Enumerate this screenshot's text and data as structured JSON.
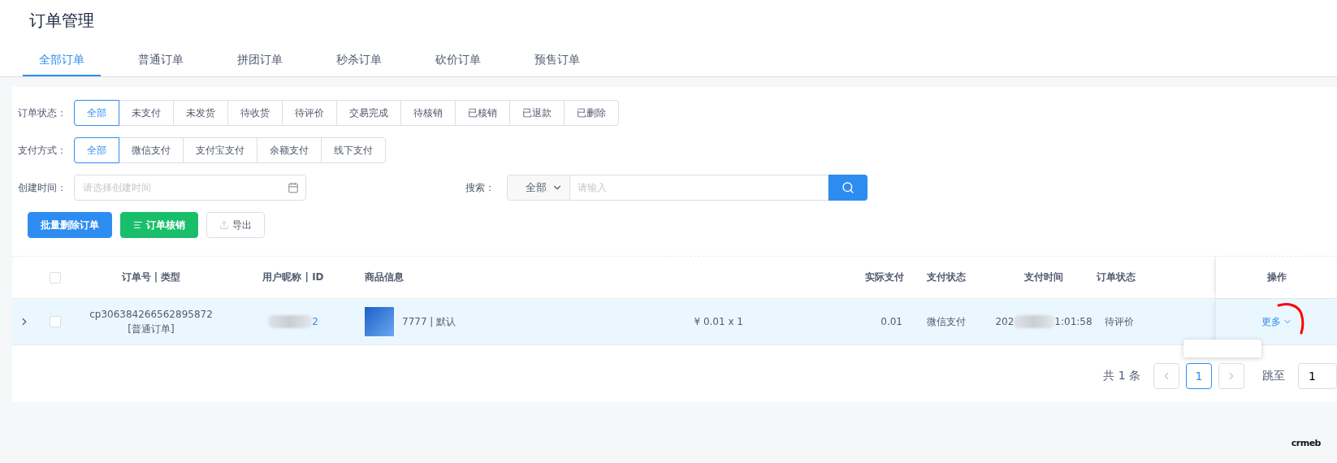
{
  "page": {
    "title": "订单管理"
  },
  "tabs": [
    {
      "label": "全部订单",
      "selected": true
    },
    {
      "label": "普通订单",
      "selected": false
    },
    {
      "label": "拼团订单",
      "selected": false
    },
    {
      "label": "秒杀订单",
      "selected": false
    },
    {
      "label": "砍价订单",
      "selected": false
    },
    {
      "label": "预售订单",
      "selected": false
    }
  ],
  "filters": {
    "order_status": {
      "label": "订单状态：",
      "options": [
        {
          "label": "全部",
          "selected": true
        },
        {
          "label": "未支付",
          "selected": false
        },
        {
          "label": "未发货",
          "selected": false
        },
        {
          "label": "待收货",
          "selected": false
        },
        {
          "label": "待评价",
          "selected": false
        },
        {
          "label": "交易完成",
          "selected": false
        },
        {
          "label": "待核销",
          "selected": false
        },
        {
          "label": "已核销",
          "selected": false
        },
        {
          "label": "已退款",
          "selected": false
        },
        {
          "label": "已删除",
          "selected": false
        }
      ]
    },
    "payment_method": {
      "label": "支付方式：",
      "options": [
        {
          "label": "全部",
          "selected": true
        },
        {
          "label": "微信支付",
          "selected": false
        },
        {
          "label": "支付宝支付",
          "selected": false
        },
        {
          "label": "余额支付",
          "selected": false
        },
        {
          "label": "线下支付",
          "selected": false
        }
      ]
    },
    "created_time": {
      "label": "创建时间：",
      "placeholder": "请选择创建时间"
    },
    "search": {
      "label": "搜索：",
      "scope": "全部",
      "placeholder": "请输入"
    }
  },
  "actions": [
    {
      "label": "批量删除订单",
      "kind": "primary"
    },
    {
      "label": "订单核销",
      "kind": "success"
    },
    {
      "label": "导出",
      "kind": "default"
    }
  ],
  "table": {
    "header_checked": false,
    "columns": [
      "订单号 | 类型",
      "用户昵称 | ID",
      "商品信息",
      "实际支付",
      "支付状态",
      "支付时间",
      "订单状态",
      "操作"
    ],
    "rows": [
      {
        "expanded": false,
        "checked": false,
        "order_no": "cp306384266562895872",
        "order_type": "[普通订单]",
        "user_id": "2",
        "product": "7777 | 默认",
        "price_qty": "¥ 0.01 x 1",
        "paid": "0.01",
        "pay_status": "微信支付",
        "pay_time_start": "202",
        "pay_time_end": "1:01:58",
        "order_status": "待评价",
        "action": "更多"
      }
    ]
  },
  "pagination": {
    "total": "共 1 条",
    "pages": [
      {
        "label": "1",
        "selected": true
      }
    ],
    "jump_label": "跳至",
    "jump_value": "1"
  },
  "footer": {
    "logo": "crmeb"
  }
}
